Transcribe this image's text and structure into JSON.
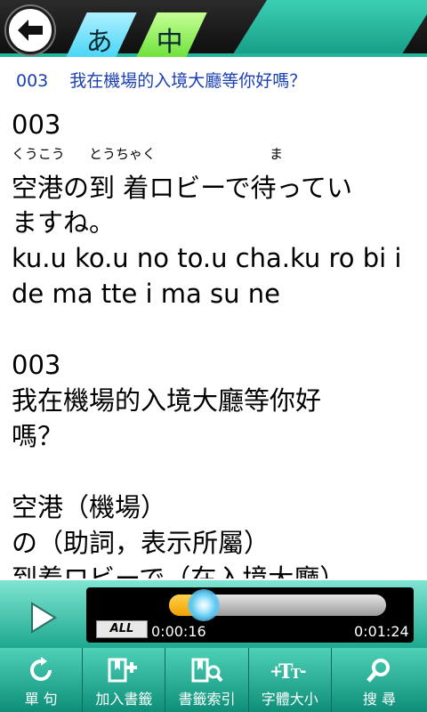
{
  "header": {
    "tab_kana": "あ",
    "tab_cn": "中"
  },
  "subtitle": {
    "number": "003",
    "text": "我在機場的入境大廳等你好嗎？"
  },
  "content": {
    "number1": "003",
    "furigana": [
      {
        "text": "くうこう",
        "pos": 0
      },
      {
        "text": "とうちゃく",
        "pos": 3
      },
      {
        "text": "ま",
        "pos": 10
      }
    ],
    "jp_line1": "空港の到 着ロビーで待ってい",
    "jp_line2": "ますね。",
    "romaji1": "ku.u ko.u no to.u cha.ku ro bi i",
    "romaji2": "de ma tte i ma su ne",
    "number2": "003",
    "cn_line1": "我在機場的入境大廳等你好",
    "cn_line2": "嗎？",
    "vocab1": "空港（機場）",
    "vocab2": "の（助詞，表示所屬）",
    "vocab3": "到着ロビーで（在入境大廳）"
  },
  "player": {
    "progress": 0.16,
    "loop_badge": "ALL",
    "current_time": "0:00:16",
    "total_time": "0:01:24"
  },
  "toolbar": {
    "items": [
      {
        "label": "單 句",
        "icon": "repeat-icon"
      },
      {
        "label": "加入書籤",
        "icon": "bookmark-add-icon"
      },
      {
        "label": "書籤索引",
        "icon": "bookmark-search-icon"
      },
      {
        "label": "字體大小",
        "icon": "font-size-icon"
      },
      {
        "label": "搜 尋",
        "icon": "search-icon"
      }
    ]
  }
}
